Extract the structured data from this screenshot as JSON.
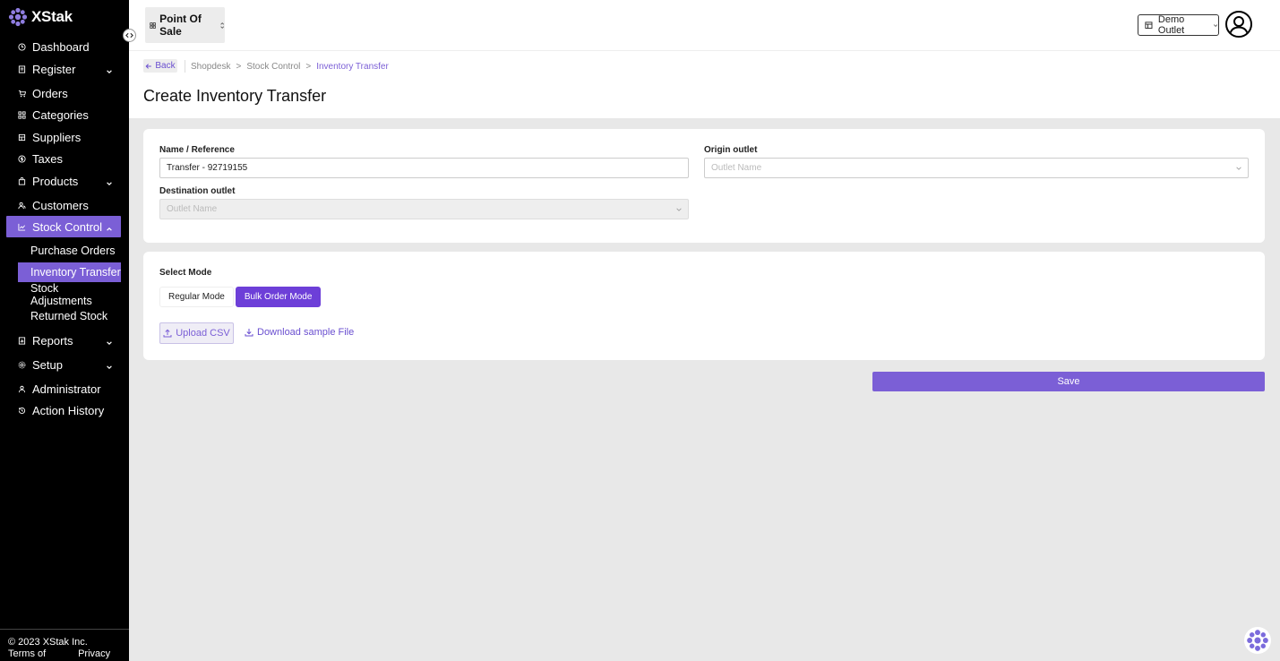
{
  "app": {
    "brand": "XStak",
    "brand_color": "#7b5fd6"
  },
  "sidebar": {
    "items": [
      {
        "label": "Dashboard",
        "icon": "clock-icon"
      },
      {
        "label": "Register",
        "icon": "register-icon"
      },
      {
        "label": "Orders",
        "icon": "cart-icon"
      },
      {
        "label": "Categories",
        "icon": "grid-icon"
      },
      {
        "label": "Suppliers",
        "icon": "building-icon"
      },
      {
        "label": "Taxes",
        "icon": "dollar-circle-icon"
      },
      {
        "label": "Products",
        "icon": "bag-icon"
      },
      {
        "label": "Customers",
        "icon": "users-icon"
      },
      {
        "label": "Stock Control",
        "icon": "chart-icon"
      },
      {
        "label": "Reports",
        "icon": "report-icon"
      },
      {
        "label": "Setup",
        "icon": "gear-icon"
      },
      {
        "label": "Administrator",
        "icon": "user-icon"
      },
      {
        "label": "Action History",
        "icon": "history-icon"
      }
    ],
    "stock_sub": [
      "Purchase Orders",
      "Inventory Transfer",
      "Stock Adjustments",
      "Returned Stock"
    ],
    "footer": {
      "copyright": "© 2023 XStak Inc.",
      "terms": "Terms of Service",
      "privacy": "Privacy Policy"
    }
  },
  "header": {
    "app_switch": "Point Of Sale",
    "outlet": "Demo Outlet"
  },
  "page": {
    "back": "Back",
    "breadcrumb": [
      "Shopdesk",
      ">",
      "Stock Control",
      ">",
      "Inventory Transfer"
    ],
    "title": "Create Inventory Transfer"
  },
  "form": {
    "name_label": "Name / Reference",
    "name_value": "Transfer - 92719155",
    "origin_label": "Origin outlet",
    "origin_placeholder": "Outlet Name",
    "dest_label": "Destination outlet",
    "dest_placeholder": "Outlet Name"
  },
  "mode": {
    "label": "Select Mode",
    "regular": "Regular Mode",
    "bulk": "Bulk Order Mode",
    "upload": "Upload CSV",
    "download": "Download sample File"
  },
  "actions": {
    "save": "Save"
  }
}
